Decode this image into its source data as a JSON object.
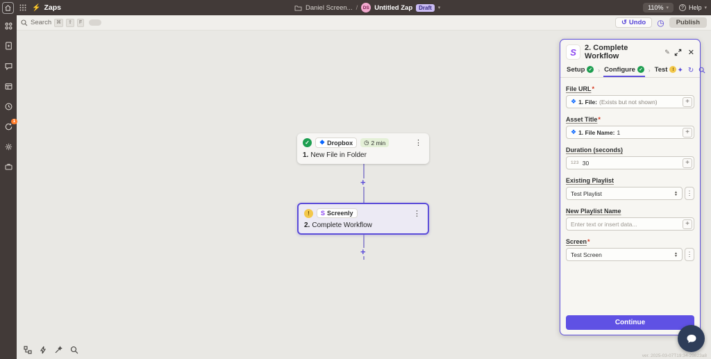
{
  "topbar": {
    "product": "Zaps",
    "breadcrumb_folder": "Daniel Screen...",
    "breadcrumb_sep": "/",
    "avatar_initials": "DS",
    "zap_title": "Untitled Zap",
    "draft_badge": "Draft",
    "zoom_level": "110%",
    "help_label": "Help"
  },
  "toolbar": {
    "search_label": "Search",
    "keys": [
      "⌘",
      "⇧",
      "F"
    ],
    "undo_label": "Undo",
    "publish_label": "Publish"
  },
  "canvas": {
    "step1": {
      "app": "Dropbox",
      "duration": "2 min",
      "number": "1.",
      "title": "New File in Folder"
    },
    "step2": {
      "app": "Screenly",
      "number": "2.",
      "title": "Complete Workflow"
    }
  },
  "panel": {
    "title": "2. Complete Workflow",
    "tabs": [
      {
        "label": "Setup"
      },
      {
        "label": "Configure"
      },
      {
        "label": "Test"
      }
    ],
    "fields": [
      {
        "label": "File URL",
        "required": "*",
        "token_label": "1. File:",
        "token_value": "(Exists but not shown)"
      },
      {
        "label": "Asset Title",
        "required": "*",
        "token_label": "1. File Name:",
        "token_value": "1"
      },
      {
        "label": "Duration (seconds)",
        "prefix": "123",
        "value": "30"
      },
      {
        "label": "Existing Playlist",
        "value": "Test Playlist"
      },
      {
        "label": "New Playlist Name",
        "placeholder": "Enter text or insert data..."
      },
      {
        "label": "Screen",
        "required": "*",
        "value": "Test Screen"
      }
    ],
    "continue_label": "Continue"
  },
  "footer": {
    "version": "ver. 2025-03-07T19:34-29823a8"
  },
  "icons": {
    "check": "✓",
    "warning": "!",
    "kebab": "⋮",
    "clock": "◷",
    "dropbox": "❖",
    "screenly_s": "S",
    "pencil": "✎",
    "close": "✕",
    "sparkle": "✦",
    "refresh": "↻",
    "undo": "↺",
    "plus": "+",
    "chevron_down": "▾",
    "select_up": "▲",
    "select_down": "▼",
    "tab_sep": "›",
    "question": "?",
    "bolt": "⚡"
  }
}
